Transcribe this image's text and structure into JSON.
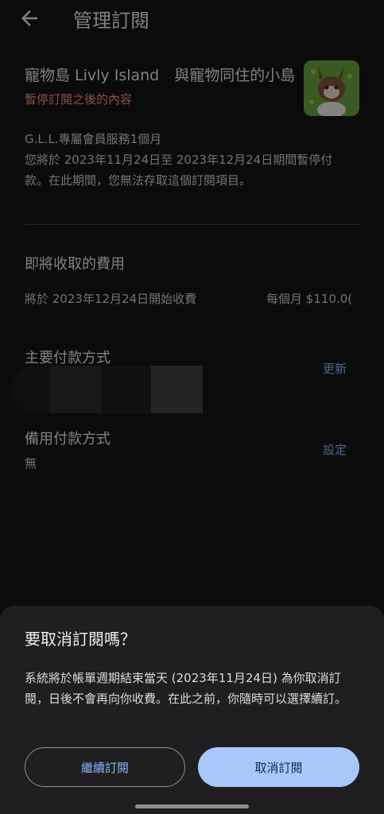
{
  "header": {
    "title": "管理訂閱"
  },
  "app": {
    "name": "寵物島 Livly Island　與寵物同住的小島",
    "status": "暫停訂閱之後的內容"
  },
  "plan": {
    "name": "G.L.L.專屬會員服務1個月",
    "description": "您將於 2023年11月24日至 2023年12月24日期間暫停付款。在此期間，您無法存取這個訂閱項目。"
  },
  "charges": {
    "title": "即將收取的費用",
    "start_text": "將於 2023年12月24日開始收費",
    "price_text": "每個月 $110.0("
  },
  "primary_payment": {
    "title": "主要付款方式",
    "action": "更新"
  },
  "backup_payment": {
    "title": "備用付款方式",
    "value": "無",
    "action": "設定"
  },
  "dialog": {
    "title": "要取消訂閱嗎？",
    "body": "系統將於帳單週期結束當天 (2023年11月24日) 為你取消訂閱，日後不會再向你收費。在此之前，你隨時可以選擇續訂。",
    "keep_label": "繼續訂閱",
    "cancel_label": "取消訂閱"
  },
  "colors": {
    "accent": "#8ab4f8",
    "primary_button": "#a8c7fa",
    "status_text": "#f08a7a",
    "sheet_background": "#1f1f21"
  }
}
